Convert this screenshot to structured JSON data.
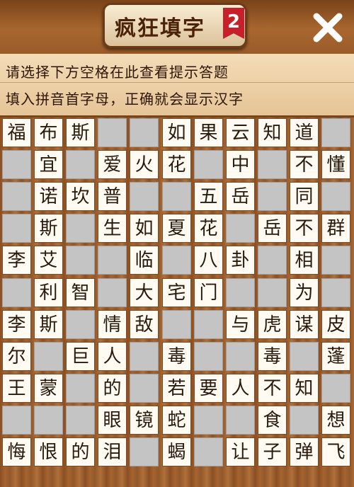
{
  "header": {
    "title": "疯狂填字",
    "badge": "2"
  },
  "hints": {
    "line1": "请选择下方空格在此查看提示答题",
    "line2": "填入拼音首字母，正确就会显示汉字"
  },
  "colors": {
    "wood": "#9a5b28",
    "cell_white": "#fffaf2",
    "cell_gray": "#c4c4c4",
    "badge_red": "#c8202a"
  },
  "grid": {
    "rows": [
      [
        "福",
        "布",
        "斯",
        null,
        null,
        "如",
        "果",
        "云",
        "知",
        "道",
        null
      ],
      [
        null,
        "宜",
        null,
        "爱",
        "火",
        "花",
        null,
        "中",
        null,
        "不",
        "懂"
      ],
      [
        null,
        "诺",
        "坎",
        "普",
        null,
        null,
        "五",
        "岳",
        null,
        "同",
        null
      ],
      [
        null,
        "斯",
        null,
        "生",
        "如",
        "夏",
        "花",
        null,
        "岳",
        "不",
        "群"
      ],
      [
        "李",
        "艾",
        null,
        null,
        "临",
        null,
        "八",
        "卦",
        null,
        "相",
        null
      ],
      [
        null,
        "利",
        "智",
        null,
        "大",
        "宅",
        "门",
        null,
        null,
        "为",
        null
      ],
      [
        "李",
        "斯",
        null,
        "情",
        "敌",
        null,
        null,
        "与",
        "虎",
        "谋",
        "皮"
      ],
      [
        "尔",
        null,
        "巨",
        "人",
        null,
        "毒",
        null,
        null,
        "毒",
        null,
        "蓬"
      ],
      [
        "王",
        "蒙",
        null,
        "的",
        null,
        "若",
        "要",
        "人",
        "不",
        "知",
        null
      ],
      [
        null,
        null,
        null,
        "眼",
        "镜",
        "蛇",
        null,
        null,
        "食",
        null,
        "想"
      ],
      [
        "悔",
        "恨",
        "的",
        "泪",
        null,
        "蝎",
        null,
        "让",
        "子",
        "弹",
        "飞"
      ]
    ]
  }
}
